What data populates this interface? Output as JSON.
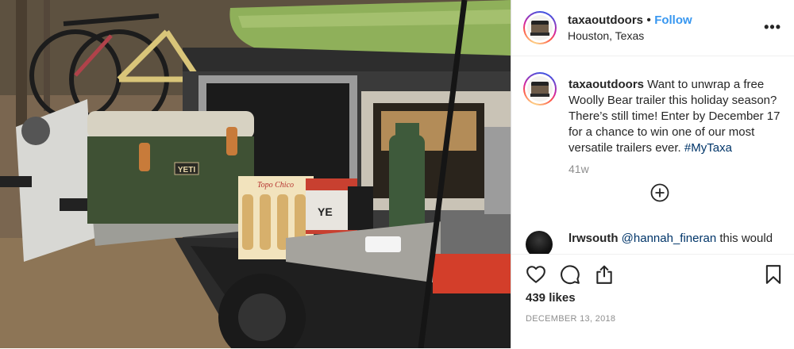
{
  "post": {
    "account": "taxaoutdoors",
    "separator": "•",
    "follow_label": "Follow",
    "location": "Houston, Texas",
    "more_icon": "•••",
    "caption_user": "taxaoutdoors",
    "caption_body": " Want to unwrap a free Woolly Bear trailer this holiday season? There’s still time! Enter by December 17 for a chance to win one of our most versatile trailers ever. ",
    "caption_hashtag": "#MyTaxa",
    "time_ago": "41w",
    "comment": {
      "user": "lrwsouth",
      "mention": "@hannah_fineran",
      "text": " this would"
    },
    "likes": "439 likes",
    "date": "DECEMBER 13, 2018"
  },
  "photo": {
    "cooler_label": "YETI",
    "crate_label": "Topo Chico",
    "bucket_label": "YE"
  },
  "icons": {
    "add": "plus-circle-icon",
    "like": "heart-icon",
    "comment": "comment-bubble-icon",
    "share": "share-icon",
    "save": "bookmark-icon",
    "more": "more-horizontal-icon"
  },
  "colors": {
    "link": "#3897f0",
    "hashtag": "#003569",
    "text": "#262626",
    "muted": "#8e8e8e"
  }
}
